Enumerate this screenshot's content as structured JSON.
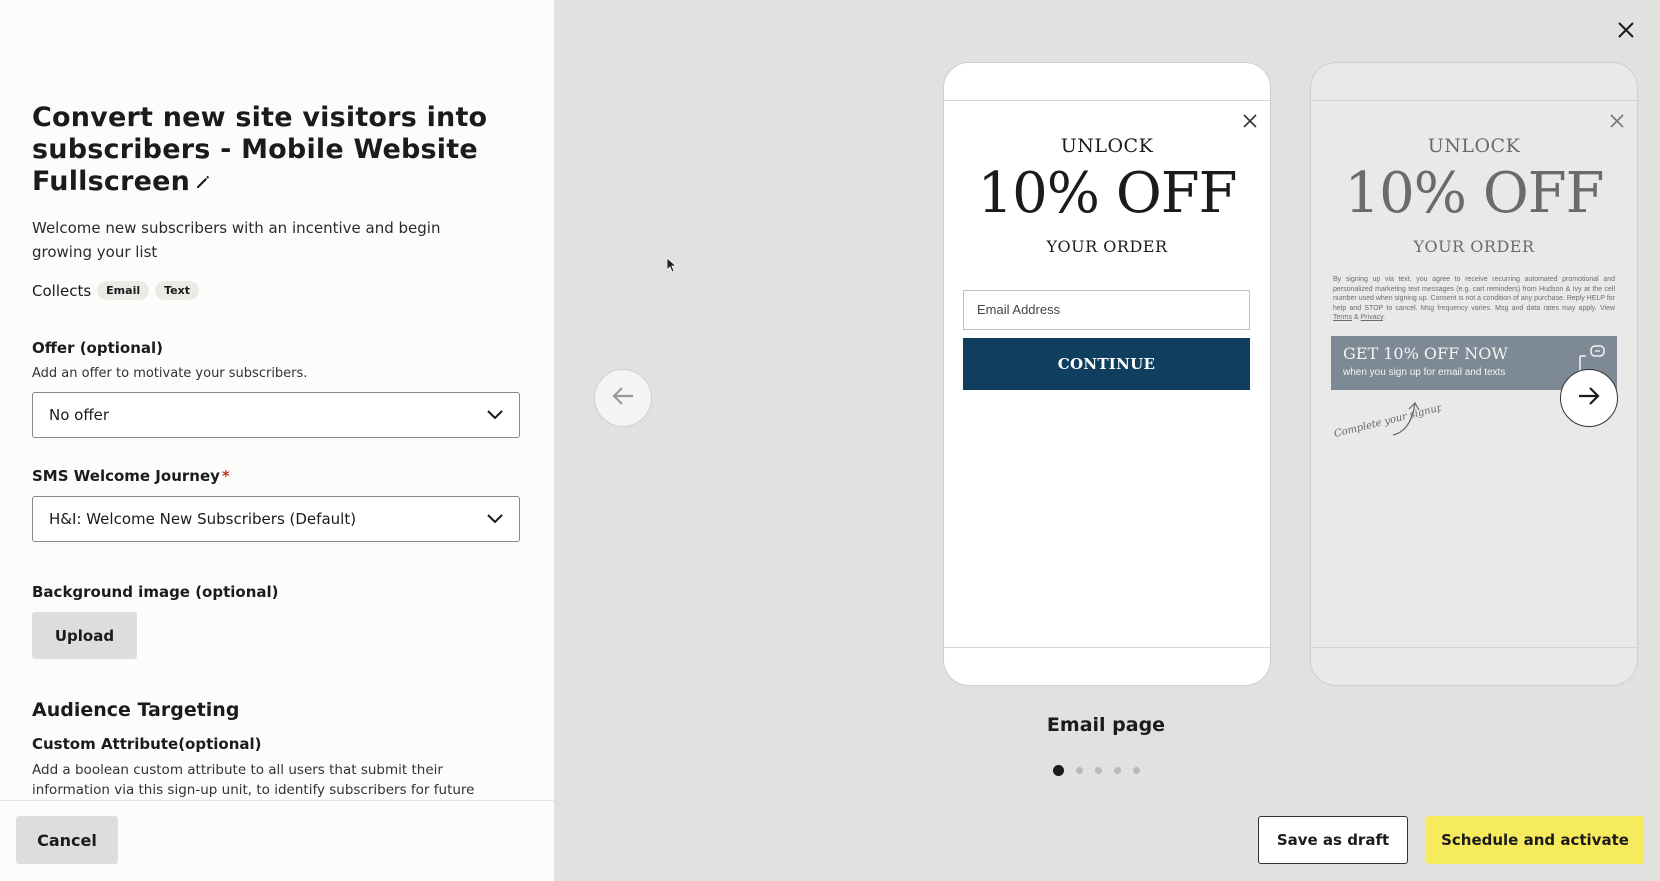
{
  "left_panel": {
    "title": "Convert new site visitors into subscribers - Mobile Website Fullscreen",
    "description": "Welcome new subscribers with an incentive and begin growing your list",
    "collects_label": "Collects",
    "collects_chips": [
      "Email",
      "Text"
    ],
    "offer": {
      "label": "Offer (optional)",
      "help": "Add an offer to motivate your subscribers.",
      "value": "No offer"
    },
    "journey": {
      "label": "SMS Welcome Journey",
      "required_mark": "*",
      "value": "H&I: Welcome New Subscribers (Default)"
    },
    "background": {
      "label": "Background image (optional)",
      "upload_label": "Upload"
    },
    "audience": {
      "heading": "Audience Targeting",
      "custom_label": "Custom Attribute(optional)",
      "custom_help": "Add a boolean custom attribute to all users that submit their information via this sign-up unit, to identify subscribers for future targeting within segments"
    },
    "cancel_label": "Cancel"
  },
  "preview": {
    "email_page": {
      "unlock": "UNLOCK",
      "offer": "10% OFF",
      "your_order": "YOUR ORDER",
      "email_placeholder": "Email Address",
      "continue": "CONTINUE"
    },
    "sms_page": {
      "unlock": "UNLOCK",
      "offer": "10% OFF",
      "your_order": "YOUR ORDER",
      "legal": "By signing up via text, you agree to receive recurring automated promotional and personalized marketing text messages (e.g. cart reminders) from Hudson & Ivy at the cell number used when signing up. Consent is not a condition of any purchase. Reply HELP for help and STOP to cancel. Msg frequency varies. Msg and data rates may apply. View",
      "legal_terms": "Terms",
      "legal_amp": "&",
      "legal_privacy": "Privacy",
      "cta_title": "GET 10% OFF NOW",
      "cta_sub": "when you sign up for email and texts",
      "scribble": "Complete your signup"
    },
    "page_label": "Email page",
    "dot_count": 5,
    "active_dot": 1
  },
  "footer": {
    "save_draft_label": "Save as draft",
    "activate_label": "Schedule and activate"
  },
  "icons": {
    "close": "close-icon",
    "pencil": "pencil-icon",
    "chevron": "chevron-down-icon",
    "arrow_left": "arrow-left-icon",
    "arrow_right": "arrow-right-icon"
  },
  "colors": {
    "continue_bg": "#0f3e5e",
    "activate_bg": "#f5eb5c",
    "required": "#c0392b",
    "cta_bg": "#7d8a95"
  }
}
